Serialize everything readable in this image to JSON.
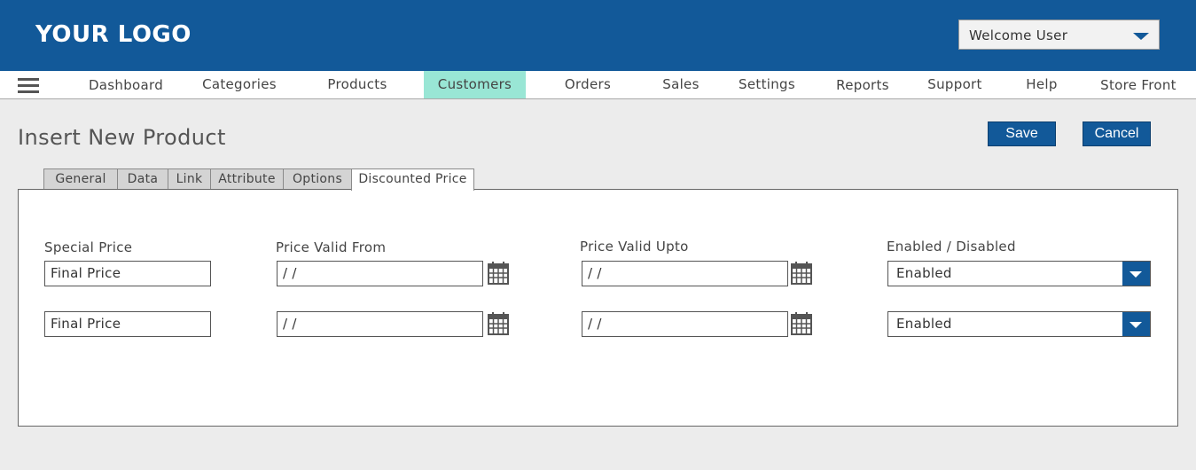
{
  "header": {
    "logo": "YOUR LOGO",
    "user_menu": "Welcome User"
  },
  "nav": {
    "items": [
      {
        "label": "Dashboard"
      },
      {
        "label": "Categories"
      },
      {
        "label": "Products"
      },
      {
        "label": "Customers",
        "active": true
      },
      {
        "label": "Orders"
      },
      {
        "label": "Sales"
      },
      {
        "label": "Settings"
      },
      {
        "label": "Reports"
      },
      {
        "label": "Support"
      },
      {
        "label": "Help"
      },
      {
        "label": "Store Front"
      }
    ]
  },
  "page": {
    "title": "Insert New Product",
    "save_label": "Save",
    "cancel_label": "Cancel"
  },
  "tabs": [
    {
      "label": "General"
    },
    {
      "label": "Data"
    },
    {
      "label": "Link"
    },
    {
      "label": "Attribute"
    },
    {
      "label": "Options"
    },
    {
      "label": "Discounted Price",
      "active": true
    }
  ],
  "form": {
    "columns": {
      "special_price": "Special Price",
      "valid_from": "Price Valid From",
      "valid_upto": "Price Valid Upto",
      "status": "Enabled / Disabled"
    },
    "rows": [
      {
        "price": "Final Price",
        "from": "/ /",
        "upto": "/ /",
        "status": "Enabled"
      },
      {
        "price": "Final Price",
        "from": "/ /",
        "upto": "/ /",
        "status": "Enabled"
      }
    ]
  },
  "icons": {
    "calendar": "calendar-icon",
    "menu": "hamburger-menu-icon",
    "dropdown": "chevron-down-icon"
  },
  "colors": {
    "brand": "#125999",
    "active_nav": "#99e6d5"
  }
}
